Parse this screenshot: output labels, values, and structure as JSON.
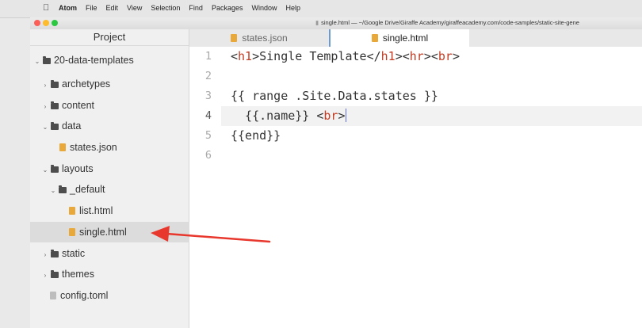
{
  "menubar": {
    "app": "Atom",
    "menus": [
      "File",
      "Edit",
      "View",
      "Selection",
      "Find",
      "Packages",
      "Window",
      "Help"
    ]
  },
  "window": {
    "title": "single.html — ~/Google Drive/Giraffe Academy/giraffeacademy.com/code-samples/static-site-gene"
  },
  "tree": {
    "header": "Project",
    "root": "20-data-templates",
    "items": [
      {
        "label": "archetypes",
        "type": "folder",
        "expanded": false
      },
      {
        "label": "content",
        "type": "folder",
        "expanded": false
      },
      {
        "label": "data",
        "type": "folder",
        "expanded": true
      },
      {
        "label": "states.json",
        "type": "file"
      },
      {
        "label": "layouts",
        "type": "folder",
        "expanded": true
      },
      {
        "label": "_default",
        "type": "folder",
        "expanded": true
      },
      {
        "label": "list.html",
        "type": "file"
      },
      {
        "label": "single.html",
        "type": "file",
        "selected": true
      },
      {
        "label": "static",
        "type": "folder",
        "expanded": false
      },
      {
        "label": "themes",
        "type": "folder",
        "expanded": false
      },
      {
        "label": "config.toml",
        "type": "file"
      }
    ]
  },
  "tabs": [
    {
      "label": "states.json",
      "active": false
    },
    {
      "label": "single.html",
      "active": true
    }
  ],
  "editor": {
    "line_numbers": [
      "1",
      "2",
      "3",
      "4",
      "5",
      "6"
    ],
    "current_line": "4",
    "line1": {
      "p1": "<",
      "t1": "h1",
      "p2": ">Single Template</",
      "t2": "h1",
      "p3": "><",
      "t3": "hr",
      "p4": "><",
      "t4": "br",
      "p5": ">"
    },
    "line3": "{{ range .Site.Data.states }}",
    "line4": {
      "p1": "  {{.name}} <",
      "t1": "br",
      "p2": ">"
    },
    "line5": "{{end}}"
  },
  "colors": {
    "accent": "#6b9bd1",
    "tag": "#c23b22",
    "annotation_arrow": "#e8372c"
  }
}
